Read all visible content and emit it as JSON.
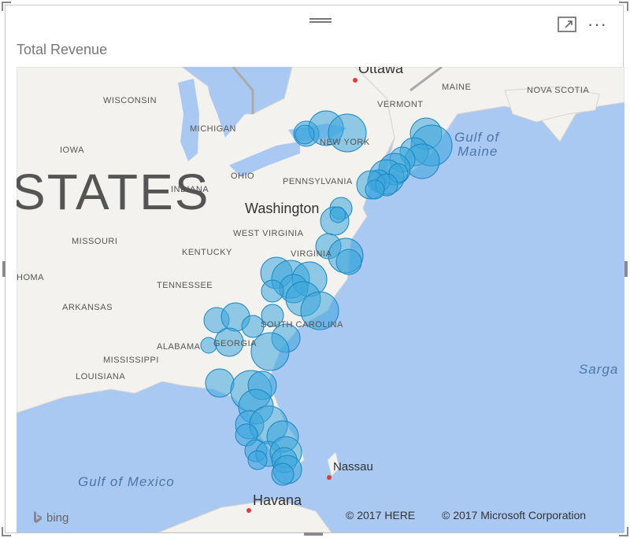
{
  "visual": {
    "title": "Total Revenue",
    "icons": [
      "focus-mode-icon",
      "more-options-icon"
    ],
    "more_glyph": "···"
  },
  "map": {
    "state_labels": [
      {
        "id": "wisconsin",
        "text": "WISCONSIN"
      },
      {
        "id": "michigan",
        "text": "MICHIGAN"
      },
      {
        "id": "iowa",
        "text": "IOWA"
      },
      {
        "id": "ohio",
        "text": "OHIO"
      },
      {
        "id": "indiana",
        "text": "INDIANA"
      },
      {
        "id": "pennsylvania",
        "text": "PENNSYLVANIA"
      },
      {
        "id": "new-york",
        "text": "NEW YORK"
      },
      {
        "id": "vermont",
        "text": "VERMONT"
      },
      {
        "id": "maine",
        "text": "MAINE"
      },
      {
        "id": "nova-scotia",
        "text": "NOVA SCOTIA"
      },
      {
        "id": "missouri",
        "text": "MISSOURI"
      },
      {
        "id": "kentucky",
        "text": "KENTUCKY"
      },
      {
        "id": "west-virginia",
        "text": "WEST VIRGINIA"
      },
      {
        "id": "virginia",
        "text": "VIRGINIA"
      },
      {
        "id": "tennessee",
        "text": "TENNESSEE"
      },
      {
        "id": "oklahoma",
        "text": "HOMA"
      },
      {
        "id": "arkansas",
        "text": "ARKANSAS"
      },
      {
        "id": "south-carolina",
        "text": "SOUTH CAROLINA"
      },
      {
        "id": "alabama",
        "text": "ALABAMA"
      },
      {
        "id": "georgia",
        "text": "GEORGIA"
      },
      {
        "id": "mississippi",
        "text": "MISSISSIPPI"
      },
      {
        "id": "louisiana",
        "text": "LOUISIANA"
      }
    ],
    "country_label": "STATES",
    "cities": {
      "ottawa": "Ottawa",
      "washington": "Washington",
      "nassau": "Nassau",
      "havana": "Havana"
    },
    "water_labels": {
      "gulf_of_maine_1": "Gulf of",
      "gulf_of_maine_2": "Maine",
      "sargasso": "Sarga",
      "gulf_of_mexico": "Gulf of Mexico"
    },
    "attribution": {
      "bing": "bing",
      "here": "© 2017 HERE",
      "microsoft": "© 2017 Microsoft Corporation"
    },
    "colors": {
      "water": "#a9c8f2",
      "land": "#f3f2ef",
      "lakes": "#a9c8f2",
      "bubble_fill": "#3aa6dd",
      "bubble_stroke": "#1a86c0"
    }
  }
}
